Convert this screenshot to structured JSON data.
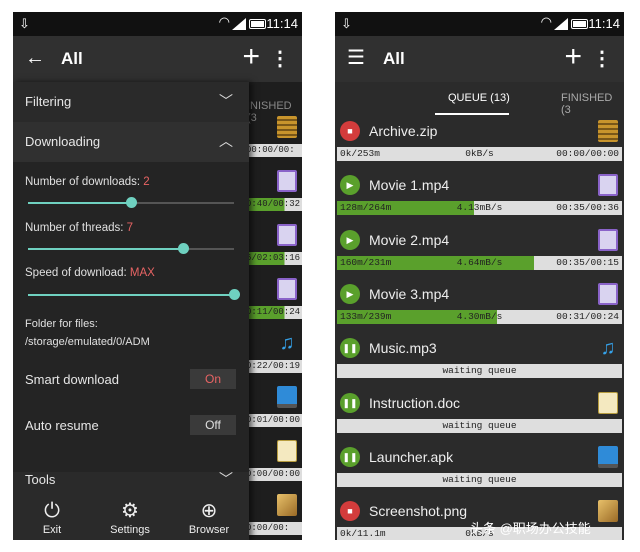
{
  "status": {
    "time": "11:14"
  },
  "left": {
    "title": "All",
    "bg_tab": "INISHED (3",
    "bg_rows": [
      "00:00/00:",
      "0:40/00:32",
      "6/02:03:16",
      "0:11/00:24",
      "0:22/00:19",
      "0:01/00:00",
      "0:00/00:00",
      "0:00/00:"
    ],
    "drawer": {
      "filtering": "Filtering",
      "downloading": "Downloading",
      "num_downloads_label": "Number of downloads:",
      "num_downloads_value": "2",
      "num_downloads_fraction": 0.5,
      "num_threads_label": "Number of threads:",
      "num_threads_value": "7",
      "num_threads_fraction": 0.75,
      "speed_label": "Speed of download:",
      "speed_value": "MAX",
      "speed_fraction": 1.0,
      "folder_label": "Folder for files:",
      "folder_path": "/storage/emulated/0/ADM",
      "smart_download": "Smart download",
      "smart_state": "On",
      "auto_resume": "Auto resume",
      "auto_state": "Off",
      "tools": "Tools"
    },
    "bottom_nav": {
      "exit": "Exit",
      "settings": "Settings",
      "browser": "Browser"
    }
  },
  "right": {
    "title": "All",
    "tabs": {
      "queue": "QUEUE (13)",
      "finished": "FINISHED (3"
    },
    "downloads": [
      {
        "name": "Archive.zip",
        "state": "stopped",
        "icon": "zip-icon",
        "left": "0k/253m",
        "center": "0kB/s",
        "right": "00:00/00:00",
        "progress": 0
      },
      {
        "name": "Movie 1.mp4",
        "state": "downloading",
        "icon": "movie-icon",
        "left": "128m/264m",
        "center": "4.13mB/s",
        "right": "00:35/00:36",
        "progress": 0.48
      },
      {
        "name": "Movie 2.mp4",
        "state": "downloading",
        "icon": "movie-icon",
        "left": "160m/231m",
        "center": "4.64mB/s",
        "right": "00:35/00:15",
        "progress": 0.69
      },
      {
        "name": "Movie 3.mp4",
        "state": "downloading",
        "icon": "movie-icon",
        "left": "133m/239m",
        "center": "4.30mB/s",
        "right": "00:31/00:24",
        "progress": 0.56
      },
      {
        "name": "Music.mp3",
        "state": "queued",
        "icon": "music-icon",
        "left": "",
        "center": "waiting queue",
        "right": "",
        "progress": 0
      },
      {
        "name": "Instruction.doc",
        "state": "queued",
        "icon": "doc-icon",
        "left": "",
        "center": "waiting queue",
        "right": "",
        "progress": 0
      },
      {
        "name": "Launcher.apk",
        "state": "queued",
        "icon": "apk-icon",
        "left": "",
        "center": "waiting queue",
        "right": "",
        "progress": 0
      },
      {
        "name": "Screenshot.png",
        "state": "stopped",
        "icon": "image-icon",
        "left": "0k/11.1m",
        "center": "0kB/s",
        "right": "",
        "progress": 0
      }
    ]
  },
  "watermark": "头条 @职场办公技能"
}
